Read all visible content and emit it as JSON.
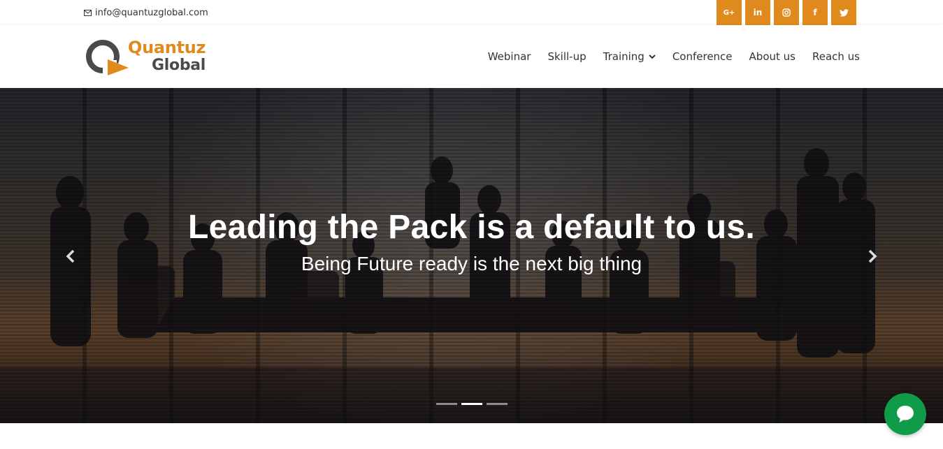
{
  "topbar": {
    "email": "info@quantuzglobal.com",
    "email_icon": "envelope-icon",
    "socials": [
      {
        "label": "G+",
        "icon": "google-plus-icon"
      },
      {
        "label": "in",
        "icon": "linkedin-icon"
      },
      {
        "label": "",
        "icon": "instagram-icon"
      },
      {
        "label": "f",
        "icon": "facebook-icon"
      },
      {
        "label": "",
        "icon": "twitter-icon"
      }
    ]
  },
  "brand": {
    "line1": "Quantuz",
    "line2": "Global"
  },
  "nav": {
    "webinar": "Webinar",
    "skillup": "Skill-up",
    "training": "Training",
    "conference": "Conference",
    "about": "About us",
    "reach": "Reach us"
  },
  "hero": {
    "title": "Leading the Pack is a default to us.",
    "subtitle": "Being Future ready is the next big thing",
    "slides_total": 3,
    "active_slide": 2
  },
  "colors": {
    "accent": "#e08a1e",
    "text_dark": "#333333",
    "logo_gray": "#4a4a4a",
    "chat_green": "#109b48"
  },
  "icons": {
    "prev": "chevron-left-icon",
    "next": "chevron-right-icon",
    "dropdown": "chevron-down-icon",
    "chat": "chat-bubble-icon"
  }
}
